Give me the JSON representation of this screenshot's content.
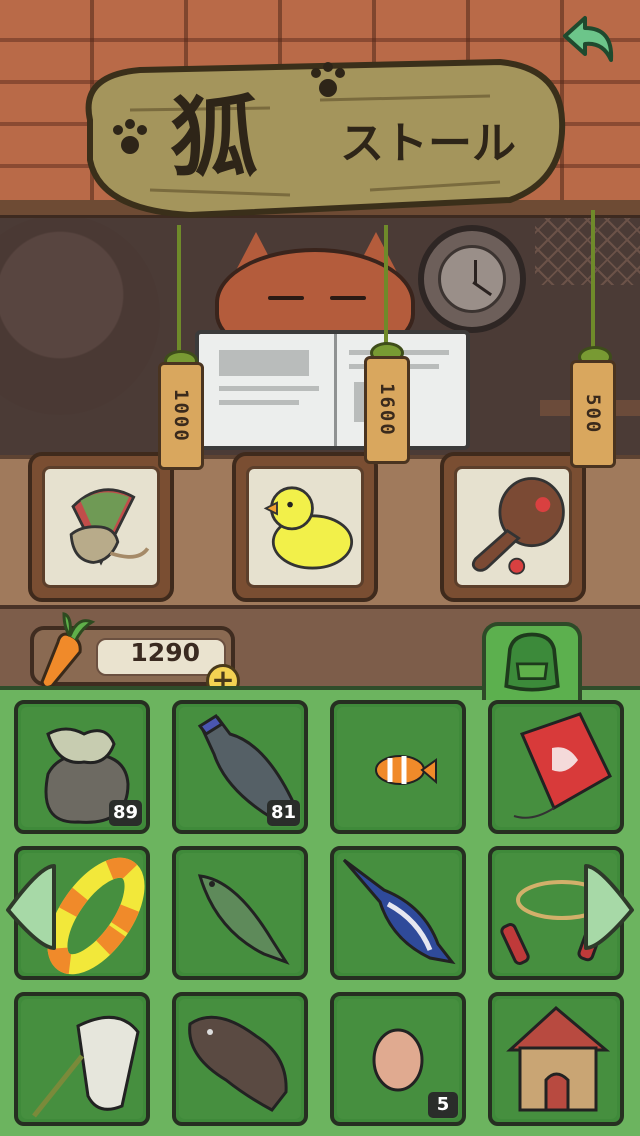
{
  "sign": {
    "kanji": "狐",
    "title": "ストール"
  },
  "shop": {
    "items": [
      {
        "icon": "spinning-top-icon",
        "price": "1000"
      },
      {
        "icon": "rubber-duck-icon",
        "price": "1600"
      },
      {
        "icon": "paddle-ball-icon",
        "price": "500"
      }
    ]
  },
  "carrots": {
    "count": "1290",
    "plus_label": "+"
  },
  "bag_tab": {
    "icon": "backpack-icon"
  },
  "inventory": {
    "items": [
      {
        "icon": "trash-bag-icon",
        "count": "89"
      },
      {
        "icon": "plastic-bottle-icon",
        "count": "81"
      },
      {
        "icon": "clownfish-icon",
        "count": ""
      },
      {
        "icon": "kite-icon",
        "count": ""
      },
      {
        "icon": "swim-ring-icon",
        "count": ""
      },
      {
        "icon": "cod-fish-icon",
        "count": ""
      },
      {
        "icon": "swordfish-icon",
        "count": ""
      },
      {
        "icon": "jump-rope-icon",
        "count": ""
      },
      {
        "icon": "fishing-net-icon",
        "count": ""
      },
      {
        "icon": "flounder-icon",
        "count": ""
      },
      {
        "icon": "egg-icon",
        "count": "5"
      },
      {
        "icon": "doghouse-icon",
        "count": ""
      }
    ]
  },
  "colors": {
    "inventory_bg": "#6cb45f",
    "cell_bg": "#3f8a3a",
    "wood": "#a07a5c",
    "tag": "#d9a75e"
  }
}
